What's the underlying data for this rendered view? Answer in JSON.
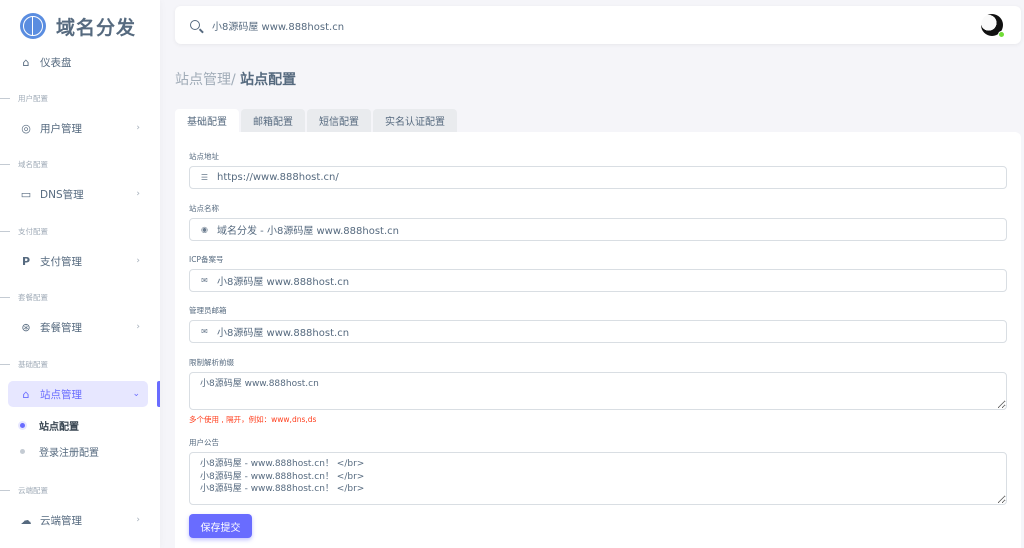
{
  "brand": {
    "name": "域名分发"
  },
  "search": {
    "value": "小8源码屋 www.888host.cn"
  },
  "sidebar": {
    "dashboard": {
      "label": "仪表盘"
    },
    "groups": [
      {
        "header": "用户配置",
        "item": "用户管理"
      },
      {
        "header": "域名配置",
        "item": "DNS管理"
      },
      {
        "header": "支付配置",
        "item": "支付管理"
      },
      {
        "header": "套餐配置",
        "item": "套餐管理"
      },
      {
        "header": "基础配置",
        "item": "站点管理"
      },
      {
        "header": "云端配置",
        "item": "云端管理"
      }
    ],
    "subitems": [
      "站点配置",
      "登录注册配置"
    ]
  },
  "breadcrumb": {
    "parent": "站点管理/",
    "current": "站点配置"
  },
  "tabs": [
    "基础配置",
    "邮箱配置",
    "短信配置",
    "实名认证配置"
  ],
  "form": {
    "site_url": {
      "label": "站点地址",
      "value": "https://www.888host.cn/"
    },
    "site_name": {
      "label": "站点名称",
      "value": "域名分发 - 小8源码屋 www.888host.cn"
    },
    "icp": {
      "label": "ICP备案号",
      "value": "小8源码屋 www.888host.cn"
    },
    "admin_email": {
      "label": "管理员邮箱",
      "value": "小8源码屋 www.888host.cn"
    },
    "restrict_prefix": {
      "label": "限制解析前缀",
      "value": "小8源码屋 www.888host.cn",
      "hint": "多个使用 , 隔开，例如：www,dns,ds"
    },
    "notice": {
      "label": "用户公告",
      "value": "小8源码屋 - www.888host.cn！ </br>\n小8源码屋 - www.888host.cn！ </br>\n小8源码屋 - www.888host.cn！ </br>"
    },
    "save_label": "保存提交"
  },
  "colors": {
    "accent": "#696cff",
    "hint": "#ff3e1d",
    "status": "#71dd37"
  }
}
